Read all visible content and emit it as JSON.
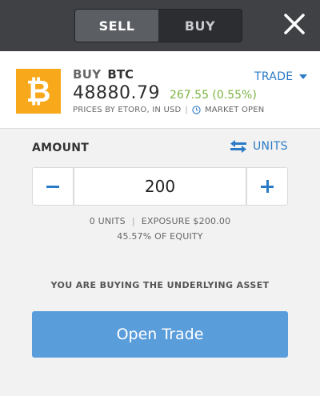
{
  "header": {
    "tabs": [
      {
        "label": "SELL",
        "active": true
      },
      {
        "label": "BUY",
        "active": false
      }
    ],
    "close_icon": "close-icon"
  },
  "instrument": {
    "logo_icon": "bitcoin-logo",
    "logo_color": "#f7a81b",
    "verb": "BUY",
    "symbol": "BTC",
    "price": "48880.79",
    "change": "267.55 (0.55%)",
    "change_color": "#7cb342",
    "source": "PRICES BY ETORO, IN USD",
    "separator": "|",
    "market_status": "MARKET OPEN",
    "trade_dropdown": "TRADE"
  },
  "amount": {
    "label": "AMOUNT",
    "units_toggle": "UNITS",
    "value": "200",
    "minus_icon": "minus-icon",
    "plus_icon": "plus-icon",
    "units_info": "0 UNITS",
    "divider": "|",
    "exposure": "EXPOSURE $200.00",
    "equity": "45.57% OF EQUITY"
  },
  "notice": "YOU ARE BUYING THE UNDERLYING ASSET",
  "action": {
    "open_trade": "Open Trade",
    "color": "#5a9ddb"
  },
  "accent_color": "#2c7bc6"
}
